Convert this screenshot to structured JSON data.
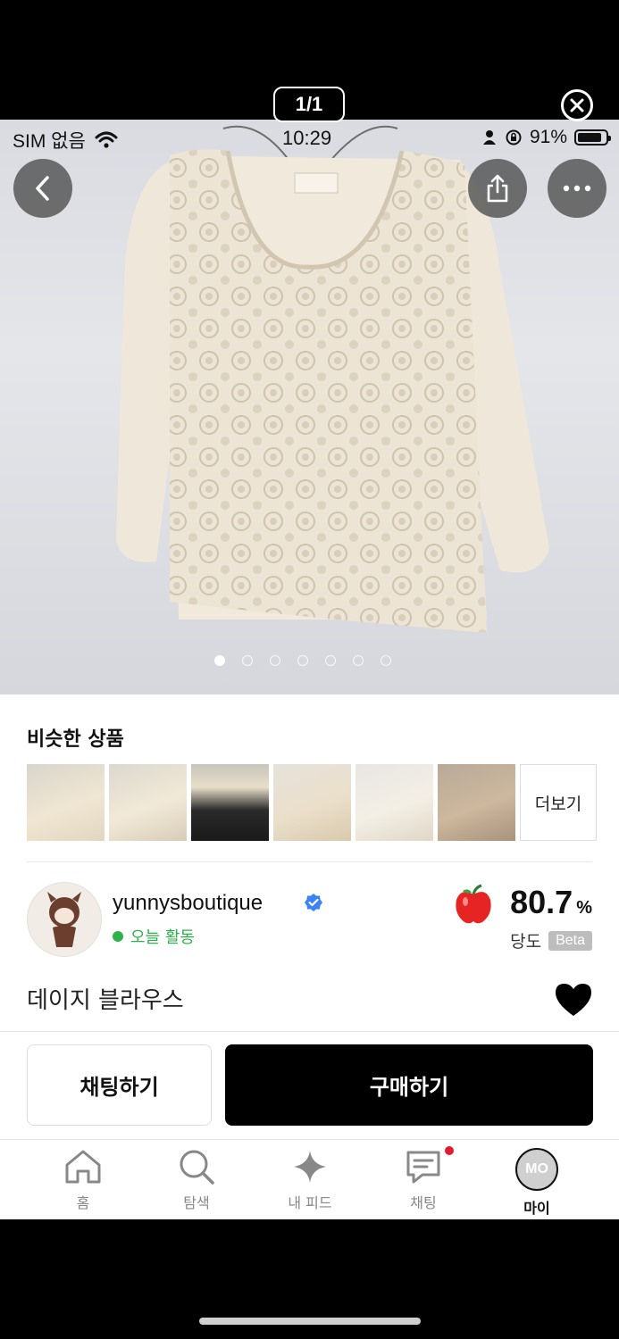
{
  "viewer": {
    "counter": "1/1"
  },
  "status_bar": {
    "carrier": "SIM 없음",
    "time": "10:29",
    "battery": "91%"
  },
  "gallery": {
    "total_images": 7,
    "current_index": 1
  },
  "similar": {
    "title": "비슷한 상품",
    "more_label": "더보기",
    "thumbnail_count": 6
  },
  "seller": {
    "name": "yunnysboutique",
    "activity": "오늘 활동",
    "sweetness_value": "80.7",
    "sweetness_unit": "%",
    "sweetness_label": "당도",
    "beta_label": "Beta"
  },
  "product": {
    "title": "데이지 블라우스"
  },
  "actions": {
    "chat": "채팅하기",
    "buy": "구매하기"
  },
  "tabbar": {
    "items": [
      {
        "label": "홈",
        "icon": "home-icon"
      },
      {
        "label": "탐색",
        "icon": "search-icon"
      },
      {
        "label": "내 피드",
        "icon": "sparkle-icon"
      },
      {
        "label": "채팅",
        "icon": "chat-icon"
      },
      {
        "label": "마이",
        "icon": "profile-icon",
        "avatar_text": "MO"
      }
    ]
  },
  "colors": {
    "online": "#2db24a",
    "badge": "#e21b2d",
    "buy": "#000000"
  }
}
